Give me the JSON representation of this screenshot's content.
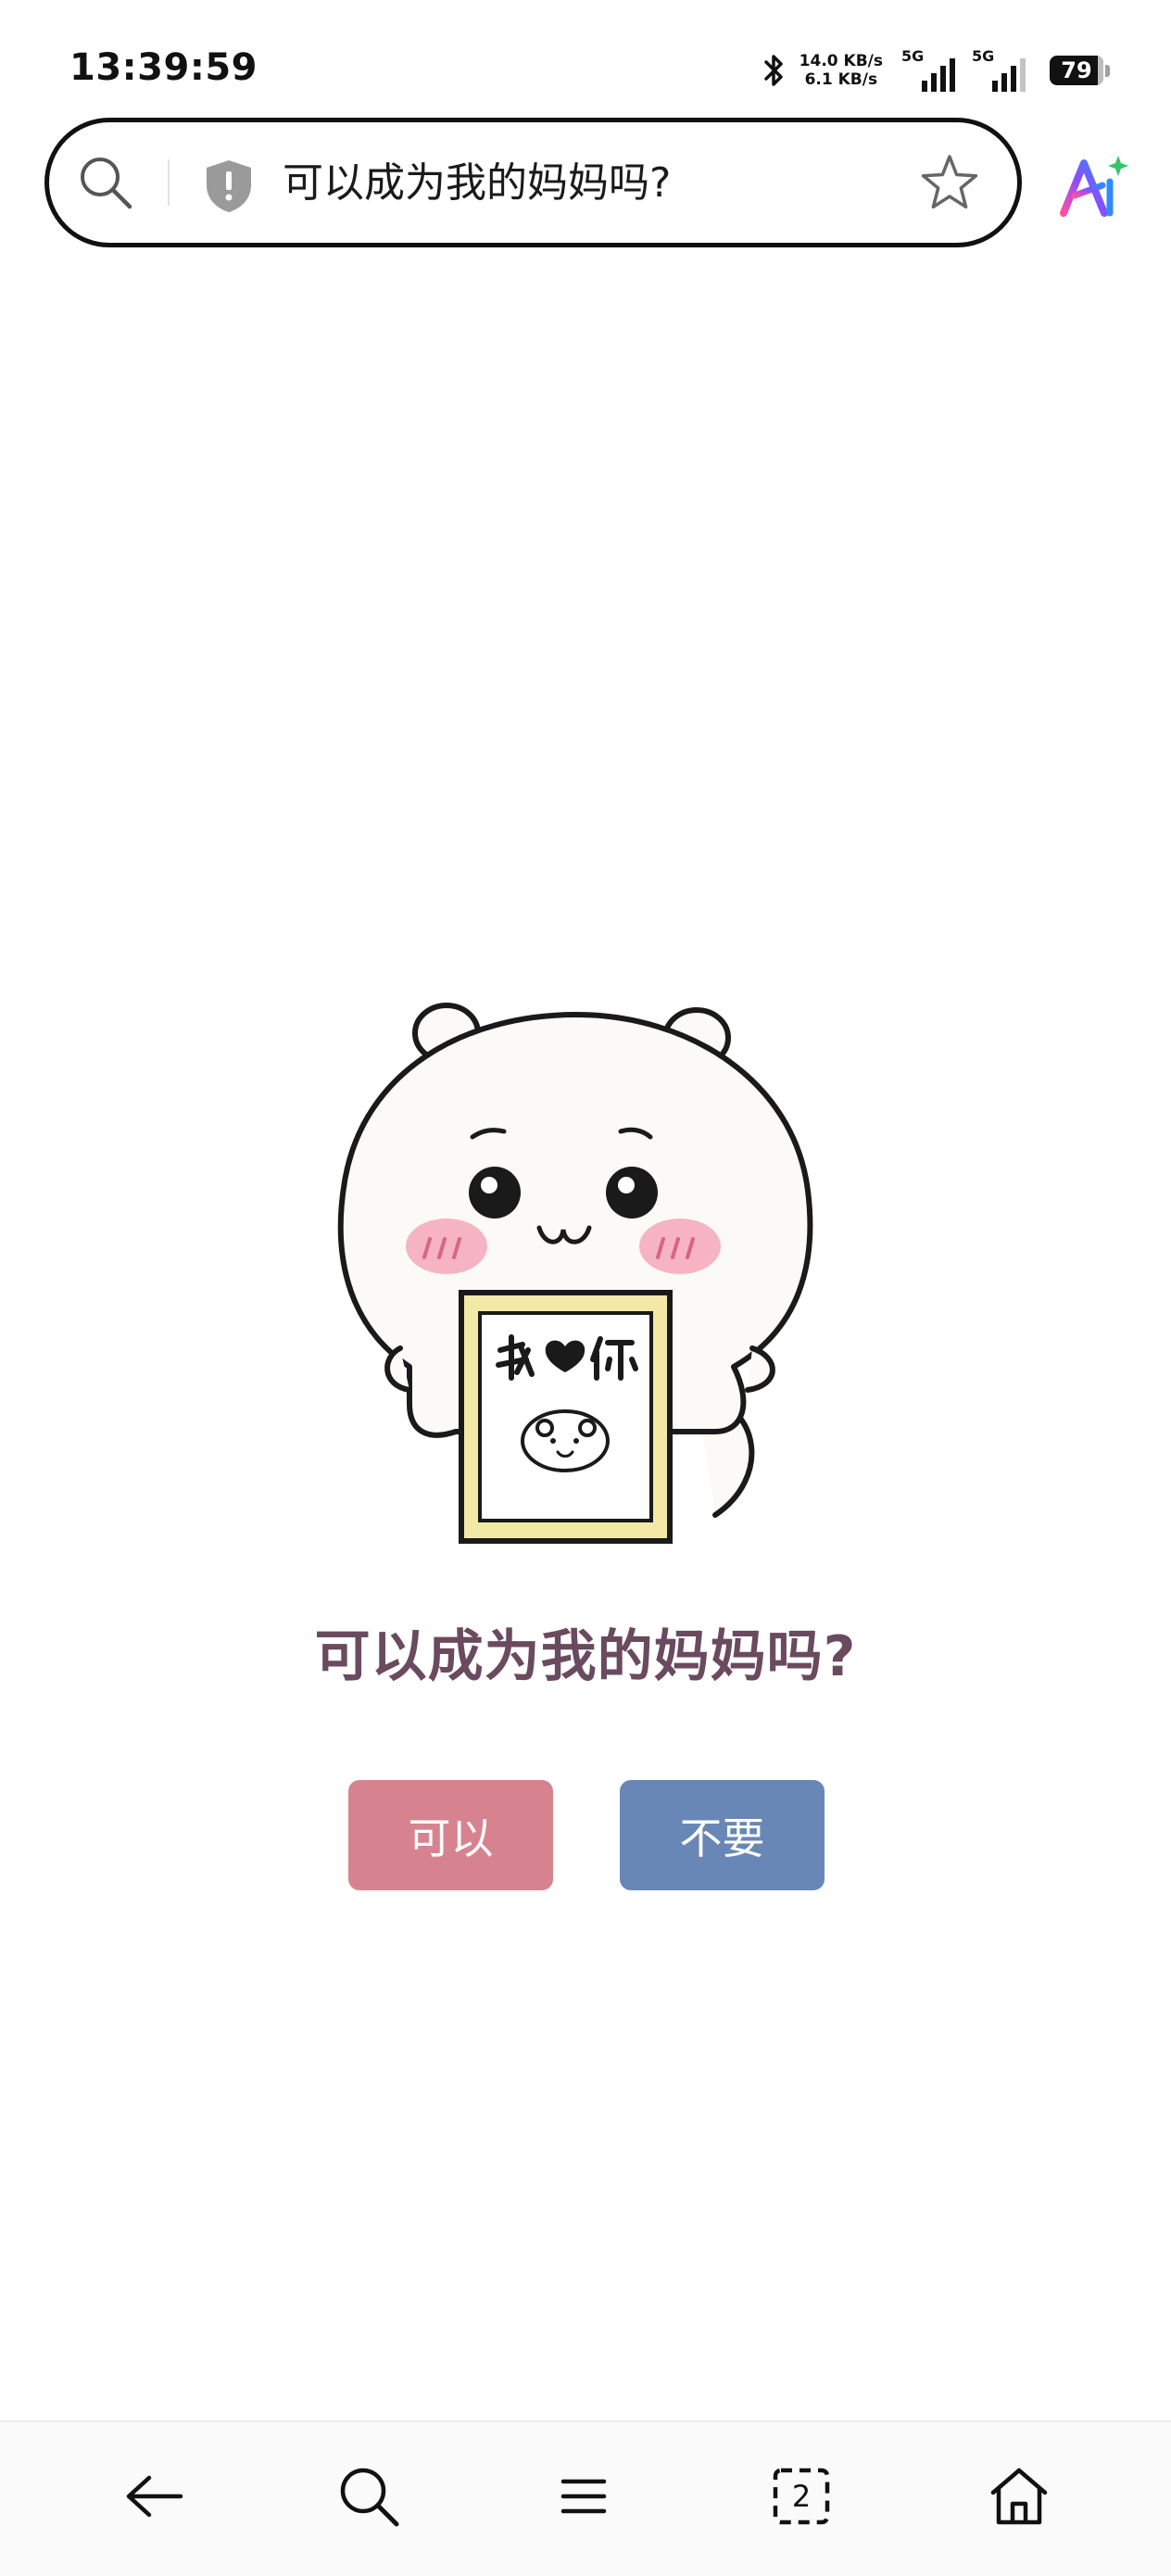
{
  "status_bar": {
    "time": "13:39:59",
    "net_speed_up": "14.0 KB/s",
    "net_speed_down": "6.1 KB/s",
    "signal_1_label": "5G",
    "signal_2_label": "5G",
    "battery_percent": "79"
  },
  "address_bar": {
    "url_text": "可以成为我的妈妈吗?"
  },
  "page": {
    "question": "可以成为我的妈妈吗?",
    "yes_label": "可以",
    "no_label": "不要",
    "yes_color": "#d7838f",
    "no_color": "#6887b6",
    "title_color": "#6a4a5f"
  },
  "bottom_nav": {
    "tab_count": "2"
  },
  "icons": {
    "address_bar": [
      "search-icon",
      "shield-icon",
      "star-icon"
    ],
    "toolbar": [
      "ai-assistant-icon"
    ],
    "bottom_nav": [
      "back-arrow-icon",
      "search-icon",
      "menu-icon",
      "tabs-icon",
      "home-icon"
    ]
  }
}
